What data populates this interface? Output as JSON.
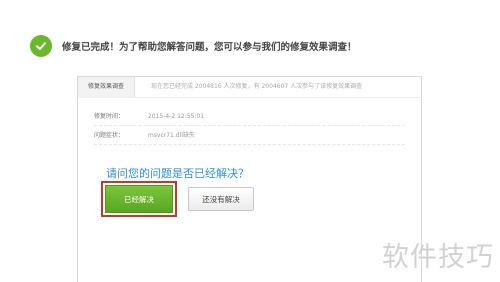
{
  "banner": {
    "icon": "check-circle-icon",
    "text": "修复已完成！为了帮助您解答问题，您可以参与我们的修复效果调查！",
    "accent_color": "#6ab82c"
  },
  "panel": {
    "tab_label": "修复效果调查",
    "tab_description": "现在您已经完成 2004816 人次修复，有 2004607 人次参与了该修复效果调查",
    "rows": [
      {
        "label": "修复时间：",
        "value": "2015-4-2 12:55:01"
      },
      {
        "label": "问题症状：",
        "value": "msvcr71.dll缺失"
      }
    ],
    "question": "请问您的问题是否已经解决？",
    "solved_button": "已经解决",
    "unsolved_button": "还没有解决"
  },
  "watermark": "软件技巧"
}
